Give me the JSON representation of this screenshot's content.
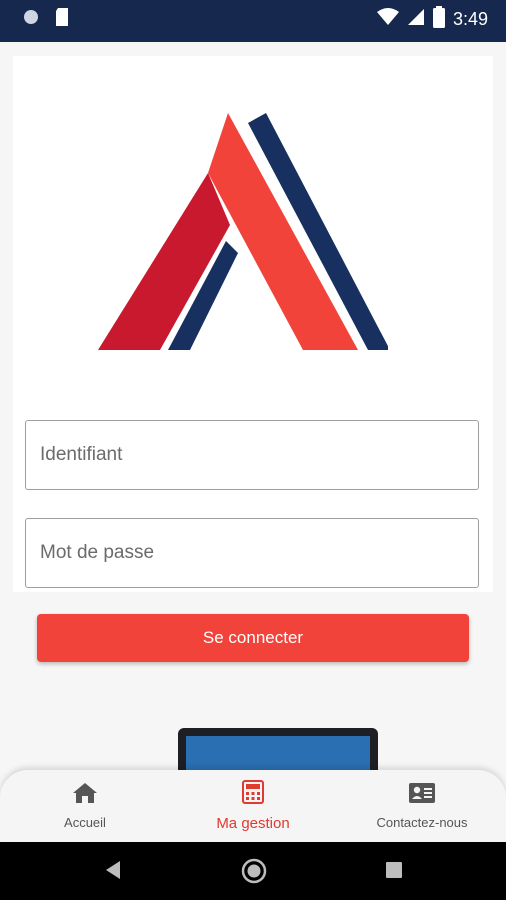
{
  "status_bar": {
    "time": "3:49"
  },
  "login": {
    "username_placeholder": "Identifiant",
    "password_placeholder": "Mot de passe",
    "submit_label": "Se connecter"
  },
  "bottom_nav": {
    "items": [
      {
        "label": "Accueil",
        "icon": "home-icon",
        "active": false
      },
      {
        "label": "Ma gestion",
        "icon": "calculator-icon",
        "active": true
      },
      {
        "label": "Contactez-nous",
        "icon": "contact-card-icon",
        "active": false
      }
    ]
  },
  "colors": {
    "status_bar": "#16284d",
    "brand_red": "#f1433a",
    "brand_dark_red": "#c8192f",
    "brand_navy": "#17305f",
    "active_nav": "#e13a2f"
  }
}
